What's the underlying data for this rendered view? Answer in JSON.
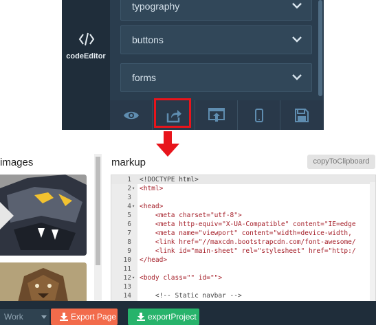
{
  "nav": {
    "label": "codeEditor",
    "icon": "code-brackets-icon"
  },
  "panels": [
    {
      "label": "typography"
    },
    {
      "label": "buttons"
    },
    {
      "label": "forms"
    }
  ],
  "toolbar": [
    {
      "name": "preview",
      "icon": "eye-icon"
    },
    {
      "name": "export",
      "icon": "share-export-icon"
    },
    {
      "name": "upload",
      "icon": "upload-window-icon"
    },
    {
      "name": "mobile",
      "icon": "mobile-icon"
    },
    {
      "name": "save",
      "icon": "floppy-disk-icon"
    }
  ],
  "images": {
    "title": "images"
  },
  "markup": {
    "title": "markup",
    "copy_label": "copyToClipboard",
    "lines": [
      {
        "n": "1",
        "fold": "",
        "text": "<!DOCTYPE html>"
      },
      {
        "n": "2",
        "fold": "▾",
        "text": "<html>"
      },
      {
        "n": "3",
        "fold": "",
        "text": ""
      },
      {
        "n": "4",
        "fold": "▾",
        "text": "<head>"
      },
      {
        "n": "5",
        "fold": "",
        "text": "    <meta charset=\"utf-8\">"
      },
      {
        "n": "6",
        "fold": "",
        "text": "    <meta http-equiv=\"X-UA-Compatible\" content=\"IE=edge"
      },
      {
        "n": "7",
        "fold": "",
        "text": "    <meta name=\"viewport\" content=\"width=device-width,"
      },
      {
        "n": "8",
        "fold": "",
        "text": "    <link href=\"//maxcdn.bootstrapcdn.com/font-awesome/"
      },
      {
        "n": "9",
        "fold": "",
        "text": "    <link id=\"main-sheet\" rel=\"stylesheet\" href=\"http:/"
      },
      {
        "n": "10",
        "fold": "",
        "text": "</head>"
      },
      {
        "n": "11",
        "fold": "",
        "text": ""
      },
      {
        "n": "12",
        "fold": "▾",
        "text": "<body class=\"\" id=\"\">"
      },
      {
        "n": "13",
        "fold": "",
        "text": ""
      },
      {
        "n": "14",
        "fold": "",
        "text": "    <!-- Static navbar -->"
      }
    ]
  },
  "bottom": {
    "work_select": "Work",
    "export_page": "Export Page",
    "export_project": "exportProject"
  },
  "colors": {
    "highlight": "#e8141b",
    "export_page": "#f26b4b",
    "export_project": "#27b36b"
  }
}
